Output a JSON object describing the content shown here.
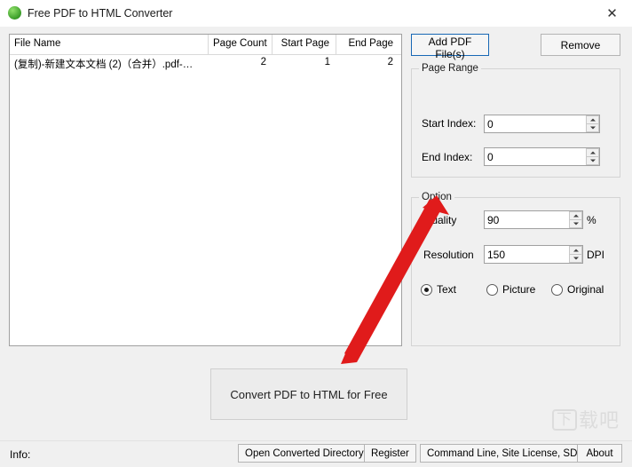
{
  "window": {
    "title": "Free PDF to HTML Converter",
    "app_icon": "green-circle-icon",
    "close_label": "✕"
  },
  "filelist": {
    "columns": [
      "File Name",
      "Page Count",
      "Start Page",
      "End Page"
    ],
    "rows": [
      {
        "file_name": "(复制)-新建文本文档 (2)（合并）.pdf-…",
        "page_count": "2",
        "start_page": "1",
        "end_page": "2"
      }
    ]
  },
  "toolbar": {
    "add_label": "Add PDF File(s)",
    "remove_label": "Remove"
  },
  "page_range": {
    "group_title": "Page Range",
    "start_index_label": "Start Index:",
    "start_index_value": "0",
    "end_index_label": "End Index:",
    "end_index_value": "0"
  },
  "option": {
    "group_title": "Option",
    "quality_label": "Quality",
    "quality_value": "90",
    "quality_unit": "%",
    "resolution_label": "Resolution",
    "resolution_value": "150",
    "resolution_unit": "DPI",
    "modes": [
      {
        "label": "Text",
        "checked": true
      },
      {
        "label": "Picture",
        "checked": false
      },
      {
        "label": "Original",
        "checked": false
      }
    ]
  },
  "convert": {
    "label": "Convert PDF to HTML for Free"
  },
  "statusbar": {
    "info_label": "Info:",
    "open_dir_label": "Open Converted Directory",
    "register_label": "Register",
    "command_line_label": "Command Line, Site License, SDK",
    "about_label": "About"
  },
  "watermark": {
    "boxed": "下",
    "text": "载吧"
  },
  "colors": {
    "accent_border": "#1868b5",
    "annotation_arrow": "#e01b1b",
    "window_bg": "#f0f0f0"
  }
}
